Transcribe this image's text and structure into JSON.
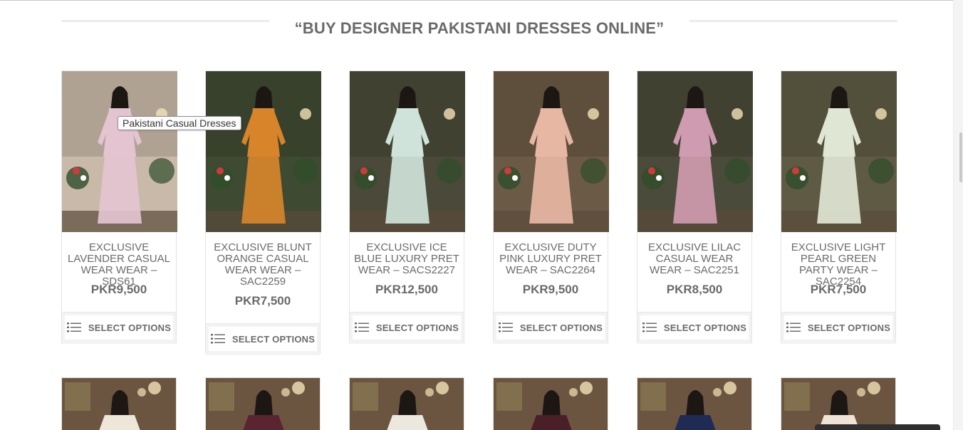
{
  "section": {
    "title": "“BUY DESIGNER PAKISTANI DRESSES ONLINE”"
  },
  "tooltip": {
    "text": "Pakistani Casual Dresses"
  },
  "products": [
    {
      "name": "EXCLUSIVE LAVENDER CASUAL WEAR WEAR – SDS61",
      "price": "PKR9,500",
      "button": "SELECT OPTIONS",
      "dress_color": "#e3c4d0"
    },
    {
      "name": "EXCLUSIVE BLUNT ORANGE CASUAL WEAR WEAR – SAC2259",
      "price": "PKR7,500",
      "button": "SELECT OPTIONS",
      "dress_color": "#d7842a"
    },
    {
      "name": "EXCLUSIVE ICE BLUE LUXURY PRET WEAR – SACS2227",
      "price": "PKR12,500",
      "button": "SELECT OPTIONS",
      "dress_color": "#cfe3da"
    },
    {
      "name": "EXCLUSIVE DUTY PINK LUXURY PRET WEAR – SAC2264",
      "price": "PKR9,500",
      "button": "SELECT OPTIONS",
      "dress_color": "#e8b7a4"
    },
    {
      "name": "EXCLUSIVE LILAC CASUAL WEAR WEAR – SAC2251",
      "price": "PKR8,500",
      "button": "SELECT OPTIONS",
      "dress_color": "#cf9bb0"
    },
    {
      "name": "EXCLUSIVE LIGHT PEARL GREEN PARTY WEAR – SAC2254",
      "price": "PKR7,500",
      "button": "SELECT OPTIONS",
      "dress_color": "#dfe6d4"
    }
  ],
  "row2_colors": [
    "#efe6da",
    "#5a2430",
    "#ece8e0",
    "#4a1f28",
    "#1f2a55",
    "#efe3d6"
  ],
  "theme": {
    "text": "#6b6b6b",
    "border": "#e4e4e4",
    "button_bg": "#f3f3f3"
  }
}
